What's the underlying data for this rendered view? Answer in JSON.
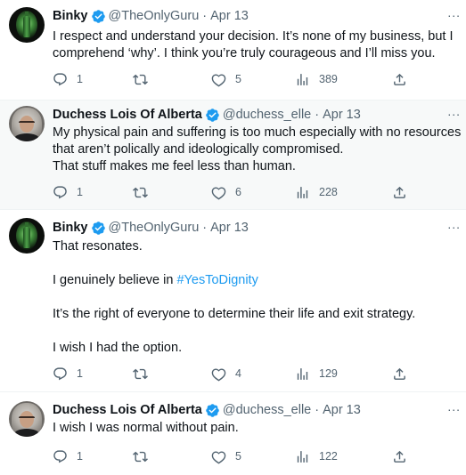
{
  "tweets": [
    {
      "name": "Binky",
      "handle": "@TheOnlyGuru",
      "separator": "·",
      "date": "Apr 13",
      "more": "...",
      "avatar": "binky-avatar",
      "lines": [
        "I respect and understand your decision. It’s none of my business, but I",
        "comprehend ‘why’. I think you’re truly courageous and I’ll miss you."
      ],
      "replies": "1",
      "retweets": "",
      "likes": "5",
      "views": "389"
    },
    {
      "name": "Duchess Lois Of Alberta",
      "handle": "@duchess_elle",
      "separator": "·",
      "date": "Apr 13",
      "more": "...",
      "avatar": "duchess-avatar",
      "lines": [
        "My physical pain and suffering is too much especially with no resources",
        "that aren’t polically and ideologically compromised.",
        "That stuff makes me feel less than human."
      ],
      "replies": "1",
      "retweets": "",
      "likes": "6",
      "views": "228"
    },
    {
      "name": "Binky",
      "handle": "@TheOnlyGuru",
      "separator": "·",
      "date": "Apr 13",
      "more": "...",
      "avatar": "binky-avatar",
      "line1": "That resonates.",
      "line2_prefix": "I genuinely believe in ",
      "hashtag": "#YesToDignity",
      "line3": "It’s the right of everyone to determine their life and exit strategy.",
      "line4": "I wish I had the option.",
      "replies": "1",
      "retweets": "",
      "likes": "4",
      "views": "129"
    },
    {
      "name": "Duchess Lois Of Alberta",
      "handle": "@duchess_elle",
      "separator": "·",
      "date": "Apr 13",
      "more": "...",
      "avatar": "duchess-avatar",
      "lines": [
        "I wish I was normal without pain."
      ],
      "replies": "1",
      "retweets": "",
      "likes": "5",
      "views": "122"
    }
  ],
  "icons": {
    "verified": "verified-badge-icon",
    "reply": "reply-icon",
    "retweet": "retweet-icon",
    "like": "heart-icon",
    "views": "views-chart-icon",
    "share": "share-icon"
  },
  "colors": {
    "verified": "#1d9bf0",
    "hashtag": "#1d9bf0",
    "secondary_text": "#536471",
    "shaded_background": "#f7f9f9"
  }
}
